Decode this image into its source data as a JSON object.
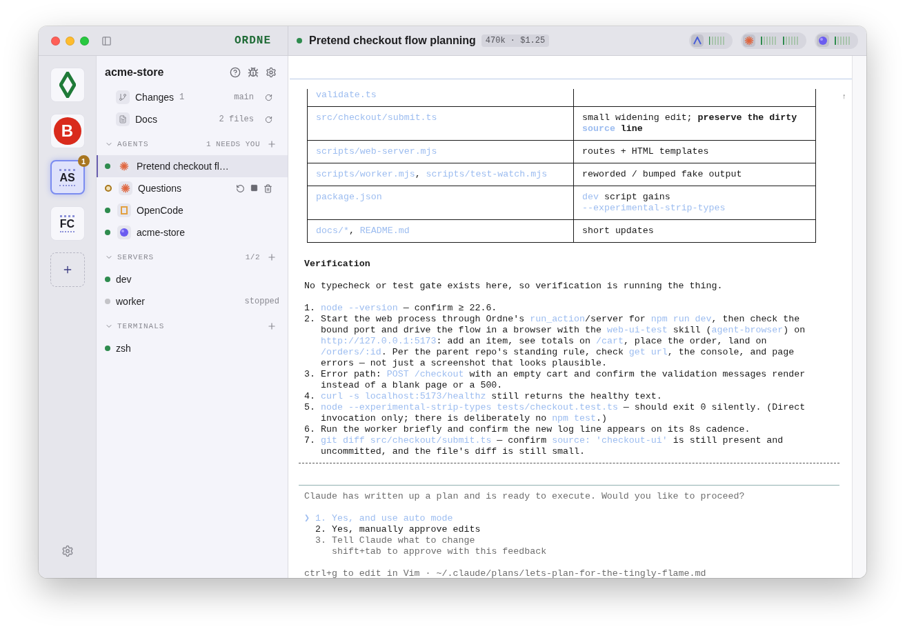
{
  "titlebar": {
    "logo": "ORDNE",
    "session": {
      "title": "Pretend checkout flow planning",
      "running": true,
      "usage": "470k · $1.25"
    },
    "providers": [
      {
        "kind": "peak",
        "meters": [
          {
            "level": 0
          }
        ]
      },
      {
        "kind": "burst",
        "meters": [
          {
            "level": 0.17
          },
          {
            "level": 0.17
          }
        ]
      },
      {
        "kind": "orb",
        "meters": [
          {
            "level": 0.17
          }
        ]
      }
    ]
  },
  "rail": {
    "projects": [
      {
        "kind": "diamond",
        "selected": false
      },
      {
        "kind": "round",
        "label": "B",
        "selected": false
      },
      {
        "kind": "monogram",
        "label": "AS",
        "selected": true,
        "badge": "1"
      },
      {
        "kind": "monogram",
        "label": "FC",
        "selected": false
      }
    ]
  },
  "sidebar": {
    "project": "acme-store",
    "links": [
      {
        "kind": "branch",
        "label": "Changes",
        "count": "1",
        "meta": "main"
      },
      {
        "kind": "doc",
        "label": "Docs",
        "meta": "2 files"
      }
    ],
    "agents": {
      "heading": "AGENTS",
      "note": "1 NEEDS YOU",
      "items": [
        {
          "name": "Pretend checkout fl…",
          "kind": "burst",
          "color": "#2e8b4e",
          "needs_input": false,
          "selected": true,
          "actions": false
        },
        {
          "name": "Questions",
          "kind": "burst",
          "color": "#a8781c",
          "needs_input": true,
          "selected": false,
          "actions": true
        },
        {
          "name": "OpenCode",
          "kind": "square",
          "color": "#2e8b4e",
          "needs_input": false,
          "selected": false,
          "actions": false
        },
        {
          "name": "acme-store",
          "kind": "orb",
          "color": "#2e8b4e",
          "needs_input": false,
          "selected": false,
          "actions": false
        }
      ]
    },
    "servers": {
      "heading": "SERVERS",
      "note": "1/2",
      "items": [
        {
          "name": "dev",
          "color": "#2e8b4e"
        },
        {
          "name": "worker",
          "color": "#c4c4c8",
          "state": "stopped"
        }
      ]
    },
    "terminals": {
      "heading": "TERMINALS",
      "items": [
        {
          "name": "zsh",
          "color": "#2e8b4e"
        }
      ]
    }
  },
  "terminal": {
    "scroll_marker": "↑",
    "table": [
      {
        "file": [
          {
            "kind": "code",
            "t": "validate.ts"
          }
        ]
      },
      {
        "file": [
          {
            "kind": "code",
            "t": "src/checkout/submit.ts"
          }
        ],
        "change": [
          {
            "kind": "plain",
            "t": "small widening edit; "
          },
          {
            "kind": "bold",
            "t": "preserve the dirty "
          },
          {
            "kind": "code-bold",
            "t": "source"
          },
          {
            "kind": "bold",
            "t": " line"
          }
        ]
      },
      {
        "file": [
          {
            "kind": "code",
            "t": "scripts/web-server.mjs"
          }
        ],
        "change": [
          {
            "kind": "plain",
            "t": "routes + HTML templates"
          }
        ]
      },
      {
        "file": [
          {
            "kind": "code",
            "t": "scripts/worker.mjs"
          },
          {
            "kind": "plain",
            "t": ", "
          },
          {
            "kind": "code",
            "t": "scripts/test-watch.mjs"
          }
        ],
        "change": [
          {
            "kind": "plain",
            "t": "reworded / bumped fake output"
          }
        ]
      },
      {
        "file": [
          {
            "kind": "code",
            "t": "package.json"
          }
        ],
        "change": [
          {
            "kind": "code",
            "t": "dev"
          },
          {
            "kind": "plain",
            "t": " script gains "
          },
          {
            "kind": "code",
            "t": "--experimental-strip-types"
          }
        ]
      },
      {
        "file": [
          {
            "kind": "code",
            "t": "docs/*"
          },
          {
            "kind": "plain",
            "t": ", "
          },
          {
            "kind": "code",
            "t": "README.md"
          }
        ],
        "change": [
          {
            "kind": "plain",
            "t": "short updates"
          }
        ]
      }
    ],
    "heading": "Verification",
    "intro": "No typecheck or test gate exists here, so verification is running the thing.",
    "steps": [
      {
        "num": "1.",
        "parts": [
          {
            "kind": "code",
            "t": "node --version"
          },
          {
            "kind": "plain",
            "t": " — confirm ≥ 22.6."
          }
        ]
      },
      {
        "num": "2.",
        "parts": [
          {
            "kind": "plain",
            "t": "Start the web process through Ordne's "
          },
          {
            "kind": "code",
            "t": "run_action"
          },
          {
            "kind": "plain",
            "t": "/server for "
          },
          {
            "kind": "code",
            "t": "npm run dev"
          },
          {
            "kind": "plain",
            "t": ", then check the bound port and drive the flow in a browser with the "
          },
          {
            "kind": "code",
            "t": "web-ui-test"
          },
          {
            "kind": "plain",
            "t": " skill ("
          },
          {
            "kind": "code",
            "t": "agent-browser"
          },
          {
            "kind": "plain",
            "t": ") on "
          },
          {
            "kind": "code",
            "t": "http://127.0.0.1:5173"
          },
          {
            "kind": "plain",
            "t": ": add an item, see totals on "
          },
          {
            "kind": "code",
            "t": "/cart"
          },
          {
            "kind": "plain",
            "t": ", place the order, land on "
          },
          {
            "kind": "code",
            "t": "/orders/:id"
          },
          {
            "kind": "plain",
            "t": ". Per the parent repo's standing rule, check "
          },
          {
            "kind": "code",
            "t": "get url"
          },
          {
            "kind": "plain",
            "t": ", the console, and page errors — not just a screenshot that looks plausible."
          }
        ]
      },
      {
        "num": "3.",
        "parts": [
          {
            "kind": "plain",
            "t": "Error path: "
          },
          {
            "kind": "code",
            "t": "POST /checkout"
          },
          {
            "kind": "plain",
            "t": " with an empty cart and confirm the validation messages render instead of a blank page or a 500."
          }
        ]
      },
      {
        "num": "4.",
        "parts": [
          {
            "kind": "code",
            "t": "curl -s localhost:5173/healthz"
          },
          {
            "kind": "plain",
            "t": " still returns the healthy text."
          }
        ]
      },
      {
        "num": "5.",
        "parts": [
          {
            "kind": "code",
            "t": "node --experimental-strip-types tests/checkout.test.ts"
          },
          {
            "kind": "plain",
            "t": " — should exit 0 silently. (Direct invocation only; there is deliberately no "
          },
          {
            "kind": "code",
            "t": "npm test"
          },
          {
            "kind": "plain",
            "t": ".)"
          }
        ]
      },
      {
        "num": "6.",
        "parts": [
          {
            "kind": "plain",
            "t": "Run the worker briefly and confirm the new log line appears on its 8s cadence."
          }
        ]
      },
      {
        "num": "7.",
        "parts": [
          {
            "kind": "code",
            "t": "git diff src/checkout/submit.ts"
          },
          {
            "kind": "plain",
            "t": " — confirm "
          },
          {
            "kind": "code",
            "t": "source: 'checkout-ui'"
          },
          {
            "kind": "plain",
            "t": " is still present and uncommitted, and the file's diff is still small."
          }
        ]
      }
    ],
    "prompt": {
      "question": "Claude has written up a plan and is ready to execute. Would you like to proceed?",
      "cursor": "❯",
      "options": [
        {
          "num": "1.",
          "label": "Yes, and use auto mode",
          "kind": "choice",
          "selected": true
        },
        {
          "num": "2.",
          "label": "Yes, manually approve edits",
          "kind": "choice",
          "selected": false
        },
        {
          "num": "3.",
          "label": "Tell Claude what to change",
          "kind": "feedback",
          "selected": false,
          "hint": "shift+tab to approve with this feedback"
        }
      ],
      "footer": "ctrl+g to edit in Vim · ~/.claude/plans/lets-plan-for-the-tingly-flame.md"
    }
  }
}
